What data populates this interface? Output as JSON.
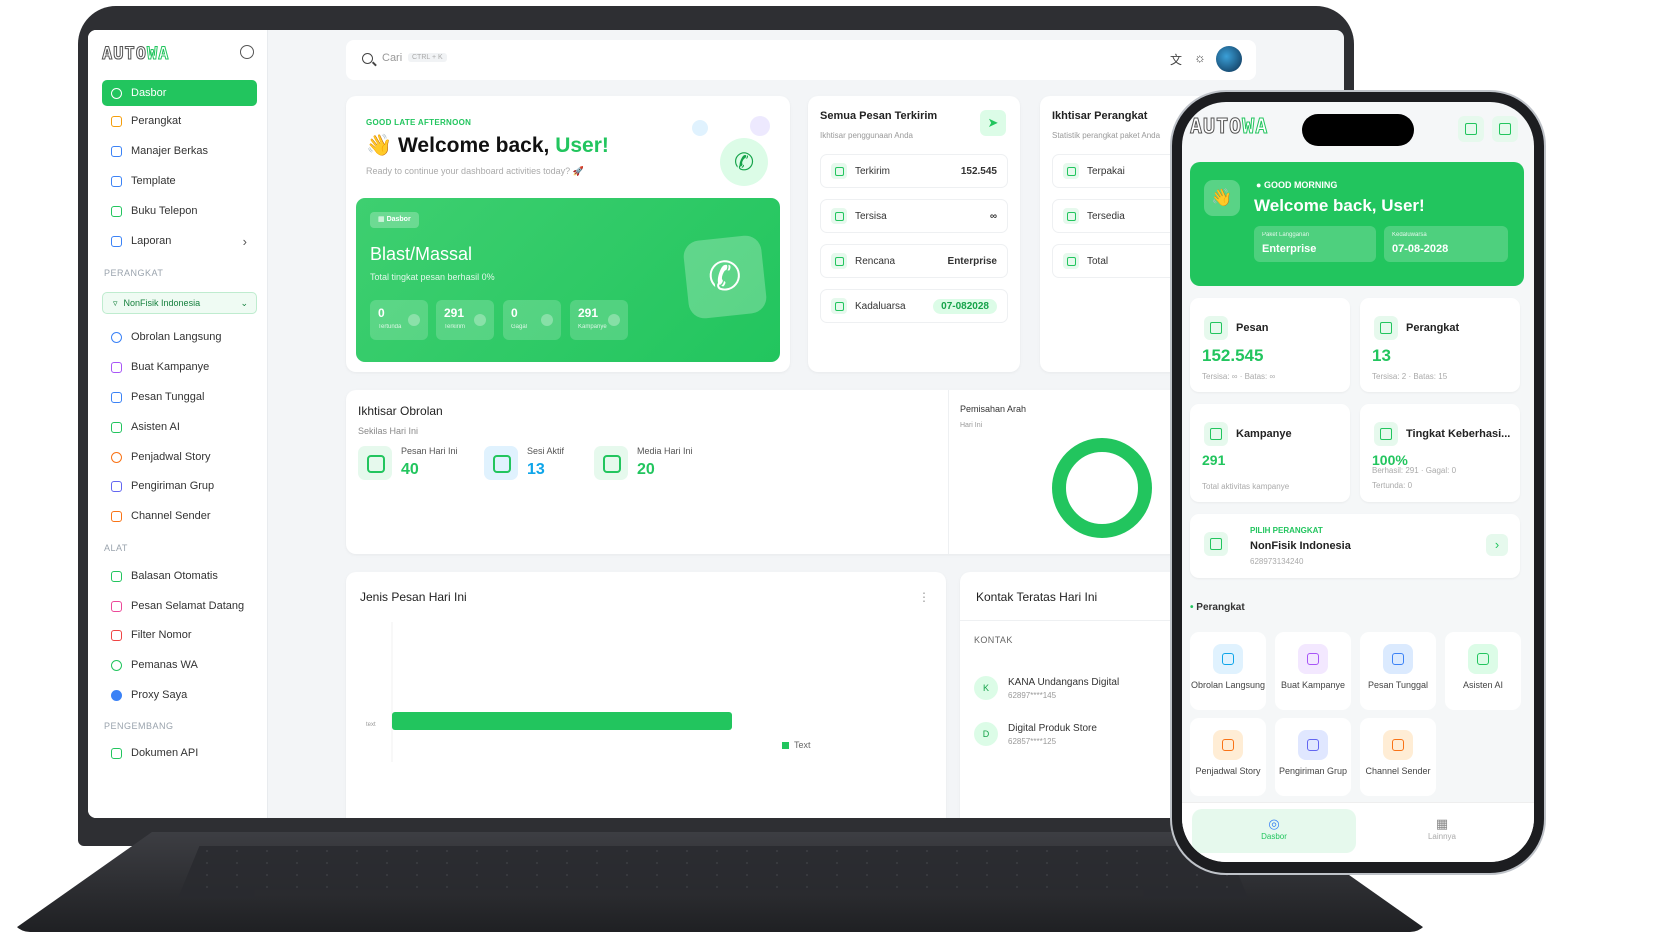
{
  "laptop": {
    "brand": {
      "logo_auto": "AUTO",
      "logo_wa": "WA"
    },
    "sidebar": {
      "items": [
        {
          "label": "Dasbor",
          "icon": "dashboard-icon",
          "active": true
        },
        {
          "label": "Perangkat",
          "icon": "device-icon"
        },
        {
          "label": "Manajer Berkas",
          "icon": "cloud-icon"
        },
        {
          "label": "Template",
          "icon": "template-icon"
        },
        {
          "label": "Buku Telepon",
          "icon": "phonebook-icon"
        },
        {
          "label": "Laporan",
          "icon": "report-icon"
        }
      ],
      "section_device": "PERANGKAT",
      "device_selector": "NonFisik Indonesia",
      "device_items": [
        {
          "label": "Obrolan Langsung",
          "icon": "whatsapp-icon"
        },
        {
          "label": "Buat Kampanye",
          "icon": "campaign-icon"
        },
        {
          "label": "Pesan Tunggal",
          "icon": "mail-icon"
        },
        {
          "label": "Asisten AI",
          "icon": "ai-icon"
        },
        {
          "label": "Penjadwal Story",
          "icon": "story-icon"
        },
        {
          "label": "Pengiriman Grup",
          "icon": "group-icon"
        },
        {
          "label": "Channel Sender",
          "icon": "megaphone-icon"
        }
      ],
      "section_tools": "ALAT",
      "tool_items": [
        {
          "label": "Balasan Otomatis",
          "icon": "autoreply-icon"
        },
        {
          "label": "Pesan Selamat Datang",
          "icon": "welcome-icon"
        },
        {
          "label": "Filter Nomor",
          "icon": "filter-icon"
        },
        {
          "label": "Pemanas WA",
          "icon": "warmer-icon"
        },
        {
          "label": "Proxy Saya",
          "icon": "globe-icon"
        }
      ],
      "section_dev": "PENGEMBANG",
      "dev_items": [
        {
          "label": "Dokumen API",
          "icon": "api-icon"
        }
      ]
    },
    "search": {
      "placeholder": "Cari",
      "shortcut": "CTRL + K"
    },
    "welcome": {
      "greeting": "GOOD LATE AFTERNOON",
      "title_prefix": "Welcome back,",
      "title_user": "User!",
      "subtitle": "Ready to continue your dashboard activities today? 🚀",
      "badge": "Dasbor",
      "blast_title": "Blast/Massal",
      "blast_sub": "Total tingkat pesan berhasil 0%",
      "mini_stats": [
        {
          "value": "0",
          "label": "Tertunda"
        },
        {
          "value": "291",
          "label": "Terkirim"
        },
        {
          "value": "0",
          "label": "Gagal"
        },
        {
          "value": "291",
          "label": "Kampanye"
        }
      ]
    },
    "sent": {
      "title": "Semua Pesan Terkirim",
      "subtitle": "Ikhtisar penggunaan Anda",
      "rows": [
        {
          "label": "Terkirim",
          "value": "152.545"
        },
        {
          "label": "Tersisa",
          "value": "∞"
        },
        {
          "label": "Rencana",
          "value": "Enterprise"
        },
        {
          "label": "Kadaluarsa",
          "value": "07-082028"
        }
      ]
    },
    "device_overview": {
      "title": "Ikhtisar Perangkat",
      "subtitle": "Statistik perangkat paket Anda",
      "rows": [
        "Terpakai",
        "Tersedia",
        "Total"
      ]
    },
    "chat_overview": {
      "title": "Ikhtisar Obrolan",
      "subtitle": "Sekilas Hari Ini",
      "stats": [
        {
          "label": "Pesan Hari Ini",
          "value": "40"
        },
        {
          "label": "Sesi Aktif",
          "value": "13"
        },
        {
          "label": "Media Hari Ini",
          "value": "20"
        }
      ],
      "split_title": "Pemisahan Arah",
      "split_sub": "Hari Ini"
    },
    "message_types": {
      "title": "Jenis Pesan Hari Ini",
      "axis_label": "text",
      "legend": "Text"
    },
    "chart_data": {
      "type": "bar",
      "categories": [
        "text"
      ],
      "series": [
        {
          "name": "Text",
          "values": [
            1
          ]
        }
      ],
      "legend": "bottom-right"
    },
    "top_contacts": {
      "title": "Kontak Teratas Hari Ini",
      "column": "KONTAK",
      "rows": [
        {
          "initial": "K",
          "name": "KANA Undangans Digital",
          "phone": "62897****145"
        },
        {
          "initial": "D",
          "name": "Digital Produk Store",
          "phone": "62857****125"
        }
      ]
    }
  },
  "phone": {
    "brand": {
      "logo_auto": "AUTO",
      "logo_wa": "WA"
    },
    "hero": {
      "greeting": "GOOD MORNING",
      "title": "Welcome back, User!",
      "plan_label": "Paket Langganan",
      "plan_value": "Enterprise",
      "expiry_label": "Kedaluwarsa",
      "expiry_value": "07-08-2028"
    },
    "cards": [
      {
        "title": "Pesan",
        "value": "152.545",
        "sub": "Tersisa: ∞ · Batas: ∞"
      },
      {
        "title": "Perangkat",
        "value": "13",
        "sub": "Tersisa: 2 · Batas: 15"
      },
      {
        "title": "Kampanye",
        "value": "291",
        "sub": "Total aktivitas kampanye"
      },
      {
        "title": "Tingkat Keberhasi...",
        "value": "100%",
        "sub": "Berhasil: 291 · Gagal: 0",
        "sub2": "Tertunda: 0"
      }
    ],
    "device_picker": {
      "label": "PILIH PERANGKAT",
      "name": "NonFisik Indonesia",
      "number": "628973134240"
    },
    "section_title": "Perangkat",
    "tiles": [
      {
        "label": "Obrolan Langsung",
        "color": "#0ea5e9",
        "bg": "#e0f2fe"
      },
      {
        "label": "Buat Kampanye",
        "color": "#a855f7",
        "bg": "#f3e8ff"
      },
      {
        "label": "Pesan Tunggal",
        "color": "#3b82f6",
        "bg": "#dbeafe"
      },
      {
        "label": "Asisten AI",
        "color": "#22c55e",
        "bg": "#dcfce7"
      },
      {
        "label": "Penjadwal Story",
        "color": "#f97316",
        "bg": "#ffedd5"
      },
      {
        "label": "Pengiriman Grup",
        "color": "#6366f1",
        "bg": "#e0e7ff"
      },
      {
        "label": "Channel Sender",
        "color": "#f97316",
        "bg": "#ffedd5"
      }
    ],
    "nav": {
      "home": "Dasbor",
      "more": "Lainnya"
    }
  }
}
